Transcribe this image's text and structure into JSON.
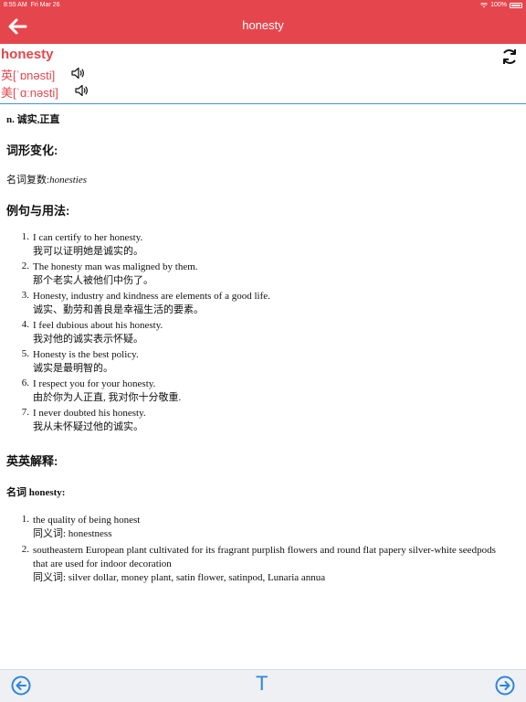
{
  "status_bar": {
    "time": "8:55 AM",
    "date": "Fri Mar 26",
    "battery": "100%"
  },
  "nav": {
    "title": "honesty"
  },
  "word": {
    "headword": "honesty",
    "uk_phonetic": "英[ˈɒnəsti]",
    "us_phonetic": "美[ˈɑːnəsti]"
  },
  "definition": {
    "main": "n. 诚实,正直"
  },
  "sections": {
    "inflection_title": "词形变化:",
    "examples_title": "例句与用法:",
    "english_title": "英英解释:"
  },
  "inflection": {
    "label": "名词复数:",
    "value": "honesties"
  },
  "examples": [
    {
      "num": "1.",
      "en": "I can certify to her honesty.",
      "zh": "我可以证明她是诚实的。"
    },
    {
      "num": "2.",
      "en": "The honesty man was maligned by them.",
      "zh": "那个老实人被他们中伤了。"
    },
    {
      "num": "3.",
      "en": "Honesty, industry and kindness are elements of a good life.",
      "zh": "诚实、勤劳和善良是幸福生活的要素。"
    },
    {
      "num": "4.",
      "en": "I feel dubious about his honesty.",
      "zh": "我对他的诚实表示怀疑。"
    },
    {
      "num": "5.",
      "en": "Honesty is the best policy.",
      "zh": "诚实是最明智的。"
    },
    {
      "num": "6.",
      "en": "I respect you for your honesty.",
      "zh": "由於你为人正直, 我对你十分敬重."
    },
    {
      "num": "7.",
      "en": "I never doubted his honesty.",
      "zh": "我从未怀疑过他的诚实。"
    }
  ],
  "english": {
    "pos_label": "名词 honesty:",
    "senses": [
      {
        "num": "1.",
        "def": "the quality of being honest",
        "syn": "同义词: honestness"
      },
      {
        "num": "2.",
        "def": "southeastern European plant cultivated for its fragrant purplish flowers and round flat papery silver-white seedpods that are used for indoor decoration",
        "syn": "同义词: silver dollar, money plant, satin flower, satinpod, Lunaria annua"
      }
    ]
  },
  "toolbar": {
    "text_label": "T"
  },
  "colors": {
    "accent_red": "#e5464d",
    "accent_blue": "#2f86d9"
  },
  "icons": {
    "back": "arrow-left-icon",
    "speaker": "speaker-icon",
    "refresh": "refresh-icon",
    "prev": "circle-arrow-left-icon",
    "next": "circle-arrow-right-icon"
  }
}
